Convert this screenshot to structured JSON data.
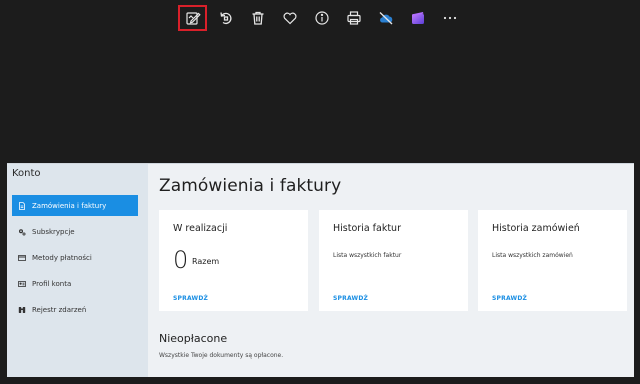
{
  "toolbar": {
    "buttons": [
      {
        "name": "edit-button",
        "icon": "edit-image-icon",
        "selected": true
      },
      {
        "name": "rotate-button",
        "icon": "rotate-icon"
      },
      {
        "name": "delete-button",
        "icon": "trash-icon"
      },
      {
        "name": "favorite-button",
        "icon": "heart-icon"
      },
      {
        "name": "info-button",
        "icon": "info-icon"
      },
      {
        "name": "print-button",
        "icon": "printer-icon"
      },
      {
        "name": "cloud-button",
        "icon": "cloud-off-icon"
      },
      {
        "name": "clipchamp-button",
        "icon": "clipchamp-icon"
      },
      {
        "name": "more-button",
        "icon": "more-icon"
      }
    ],
    "highlight_color": "#d9202a"
  },
  "sidebar": {
    "title": "Konto",
    "items": [
      {
        "label": "Zamówienia i faktury",
        "icon": "document-icon",
        "active": true
      },
      {
        "label": "Subskrypcje",
        "icon": "gears-icon"
      },
      {
        "label": "Metody płatności",
        "icon": "credit-card-icon"
      },
      {
        "label": "Profil konta",
        "icon": "profile-card-icon"
      },
      {
        "label": "Rejestr zdarzeń",
        "icon": "binoculars-icon"
      }
    ]
  },
  "main": {
    "title": "Zamówienia i faktury",
    "cards": [
      {
        "title": "W realizacji",
        "count": "0",
        "count_label": "Razem",
        "link": "SPRAWDŹ"
      },
      {
        "title": "Historia faktur",
        "subtitle": "Lista wszystkich faktur",
        "link": "SPRAWDŹ"
      },
      {
        "title": "Historia zamówień",
        "subtitle": "Lista wszystkich zamówień",
        "link": "SPRAWDŹ"
      }
    ],
    "unpaid": {
      "title": "Nieopłacone",
      "text": "Wszystkie Twoje dokumenty są opłacone."
    }
  },
  "colors": {
    "accent": "#1a8ee3",
    "sidebar_bg": "#dde5ec",
    "page_bg": "#eef1f4",
    "viewer_bg": "#1c1c1c"
  }
}
